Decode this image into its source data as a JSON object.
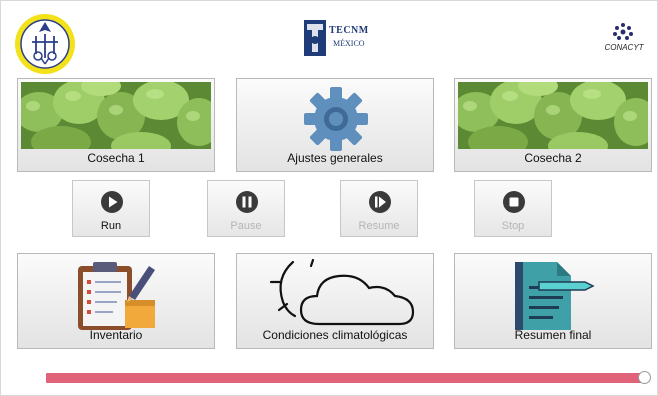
{
  "header": {
    "logo_left_icon": "institute-seal-logo",
    "logo_center_text": "TECNM",
    "logo_center_subtext": "MÉXICO",
    "logo_right_text": "CONACYT"
  },
  "harvest": {
    "cosecha1_label": "Cosecha 1",
    "ajustes_label": "Ajustes generales",
    "cosecha2_label": "Cosecha 2"
  },
  "controls": {
    "run_label": "Run",
    "pause_label": "Pause",
    "resume_label": "Resume",
    "stop_label": "Stop"
  },
  "modules": {
    "inventario_label": "Inventario",
    "condiciones_label": "Condiciones climatológicas",
    "resumen_label": "Resumen final"
  },
  "slider": {
    "value_fraction": 1.0,
    "track_color": "#e0637a"
  }
}
